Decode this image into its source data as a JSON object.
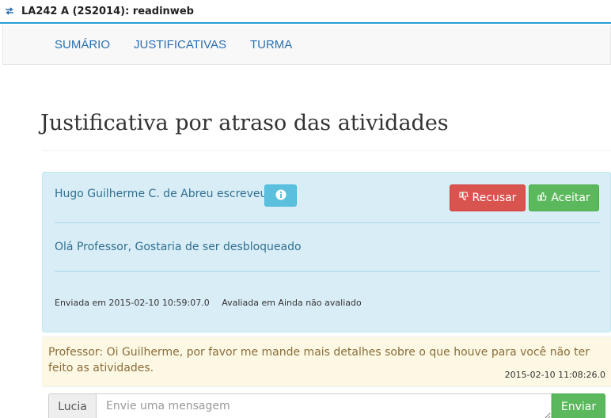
{
  "window": {
    "title": "LA242 A (2S2014): readinweb",
    "icon": "app-arrows-icon"
  },
  "nav": {
    "items": [
      {
        "label": "SUMÁRIO"
      },
      {
        "label": "JUSTIFICATIVAS"
      },
      {
        "label": "TURMA"
      }
    ]
  },
  "page": {
    "title": "Justificativa por atraso das atividades"
  },
  "message": {
    "author": "Hugo Guilherme C. de Abreu escreveu:",
    "body": "Olá Professor, Gostaria de ser desbloqueado",
    "sent_label": "Enviada em 2015-02-10 10:59:07.0",
    "evaluated_label": "Avaliada em Ainda não avaliado",
    "info_icon": "info-icon",
    "reject_label": "Recusar",
    "reject_icon": "thumbs-down-icon",
    "accept_label": "Aceitar",
    "accept_icon": "thumbs-up-icon"
  },
  "reply": {
    "text": "Professor: Oi Guilherme, por favor me mande mais detalhes sobre o que houve para você não ter feito as atividades.",
    "date": "2015-02-10 11:08:26.0"
  },
  "composer": {
    "user": "Lucia",
    "placeholder": "Envie uma mensagem",
    "send_label": "Enviar"
  },
  "colors": {
    "accent": "#2a9fd6",
    "link": "#2c6fb0",
    "info_panel": "#d9edf7",
    "danger": "#d9534f",
    "success": "#5cb85c",
    "warning_panel": "#fcf8e3"
  }
}
